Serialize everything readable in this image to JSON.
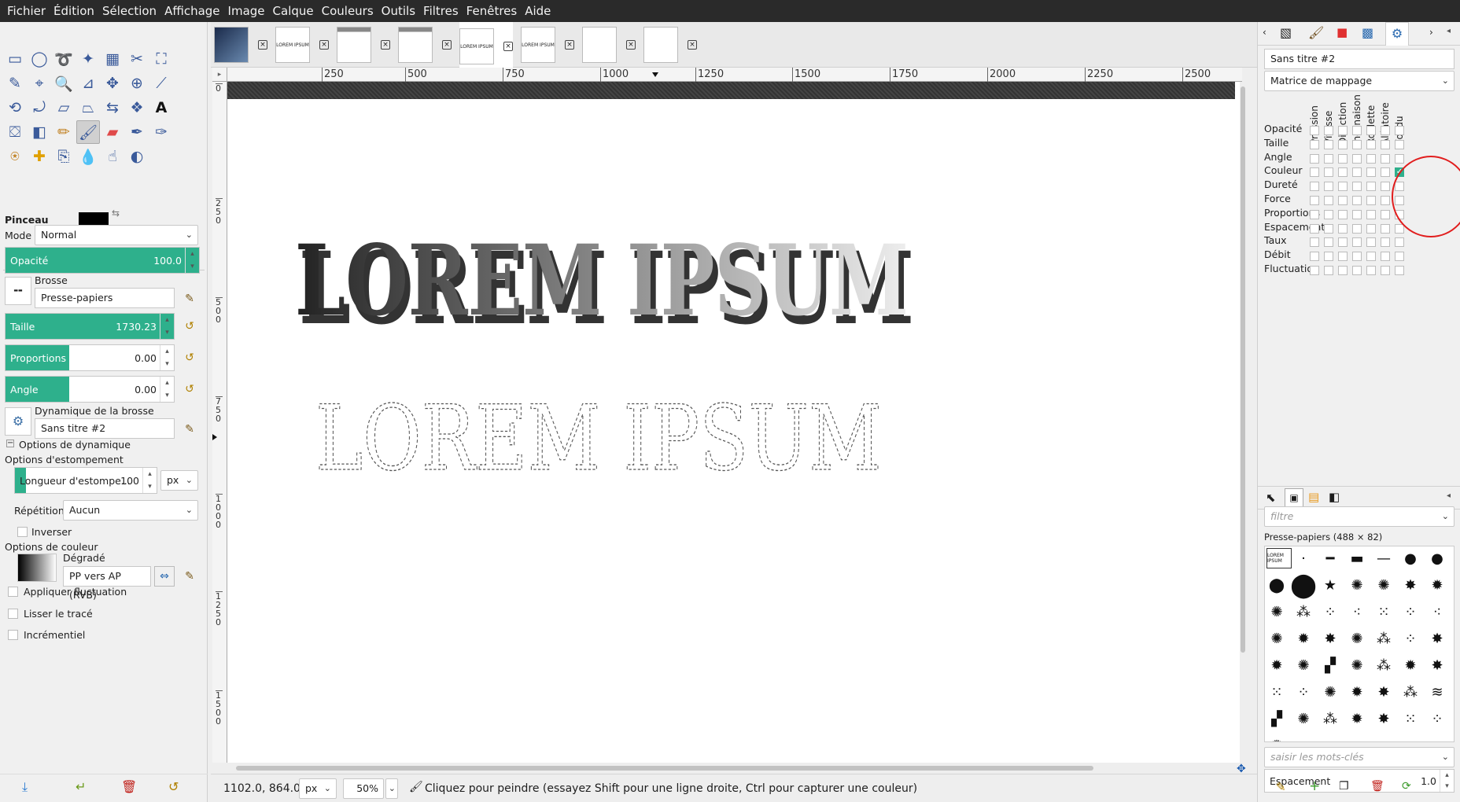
{
  "menu": [
    "Fichier",
    "Édition",
    "Sélection",
    "Affichage",
    "Image",
    "Calque",
    "Couleurs",
    "Outils",
    "Filtres",
    "Fenêtres",
    "Aide"
  ],
  "image_tabs": [
    "",
    "LOREM IPSUM",
    "",
    "",
    "LOREM IPSUM",
    "LOREM IPSUM",
    "",
    ""
  ],
  "tool_options": {
    "title": "Pinceau",
    "mode_label": "Mode :",
    "mode_value": "Normal",
    "opacity_label": "Opacité",
    "opacity_value": "100.0",
    "brush_label": "Brosse",
    "brush_value": "Presse-papiers",
    "size_label": "Taille",
    "size_value": "1730.23",
    "proportions_label": "Proportions",
    "proportions_value": "0.00",
    "angle_label": "Angle",
    "angle_value": "0.00",
    "dynamics_label": "Dynamique de la brosse",
    "dynamics_value": "Sans titre #2",
    "dynamics_options_label": "Options de dynamique",
    "fade_options_label": "Options d'estompement",
    "fade_length_label": "Longueur d'estompe...",
    "fade_length_value": "100",
    "fade_unit": "px",
    "repeat_label": "Répétition :",
    "repeat_value": "Aucun",
    "invert_label": "Inverser",
    "color_options_label": "Options de couleur",
    "gradient_label": "Dégradé",
    "gradient_value": "PP vers AP (RVB)",
    "apply_jitter_label": "Appliquer fluctuation",
    "smooth_label": "Lisser le tracé",
    "incremental_label": "Incrémentiel"
  },
  "ruler": {
    "h_ticks": [
      "250",
      "500",
      "750",
      "1000",
      "1250",
      "1500",
      "1750",
      "2000",
      "2250",
      "2500"
    ],
    "v_ticks": [
      "0",
      "250",
      "500",
      "750",
      "1000",
      "1250",
      "1500"
    ]
  },
  "canvas": {
    "text_filled": "LOREM IPSUM",
    "text_outline": "LOREM IPSUM"
  },
  "status": {
    "coords": "1102.0, 864.0",
    "unit": "px",
    "zoom": "50%",
    "message": "Cliquez pour peindre (essayez Shift pour une ligne droite, Ctrl pour capturer une couleur)"
  },
  "dynamics_editor": {
    "name": "Sans titre #2",
    "mapping": "Matrice de mappage",
    "columns": [
      "Pression",
      "Vitesse",
      "Direction",
      "Inclinaison",
      "Roulette",
      "Aléatoire",
      "Fondu"
    ],
    "rows": [
      "Opacité",
      "Taille",
      "Angle",
      "Couleur",
      "Dureté",
      "Force",
      "Proportions",
      "Espacement",
      "Taux",
      "Débit",
      "Fluctuation"
    ],
    "checked": [
      {
        "row": "Couleur",
        "col": "Fondu"
      }
    ]
  },
  "brushes": {
    "filter_placeholder": "filtre",
    "selected_brush": "Presse-papiers (488 × 82)",
    "tags_placeholder": "saisir les mots-clés",
    "spacing_label": "Espacement",
    "spacing_value": "1.0"
  },
  "colors": {
    "accent": "#2eb08c",
    "menubar": "#2a2a2a",
    "highlight_circle": "#e11d1d",
    "check": "#2eb08c"
  }
}
